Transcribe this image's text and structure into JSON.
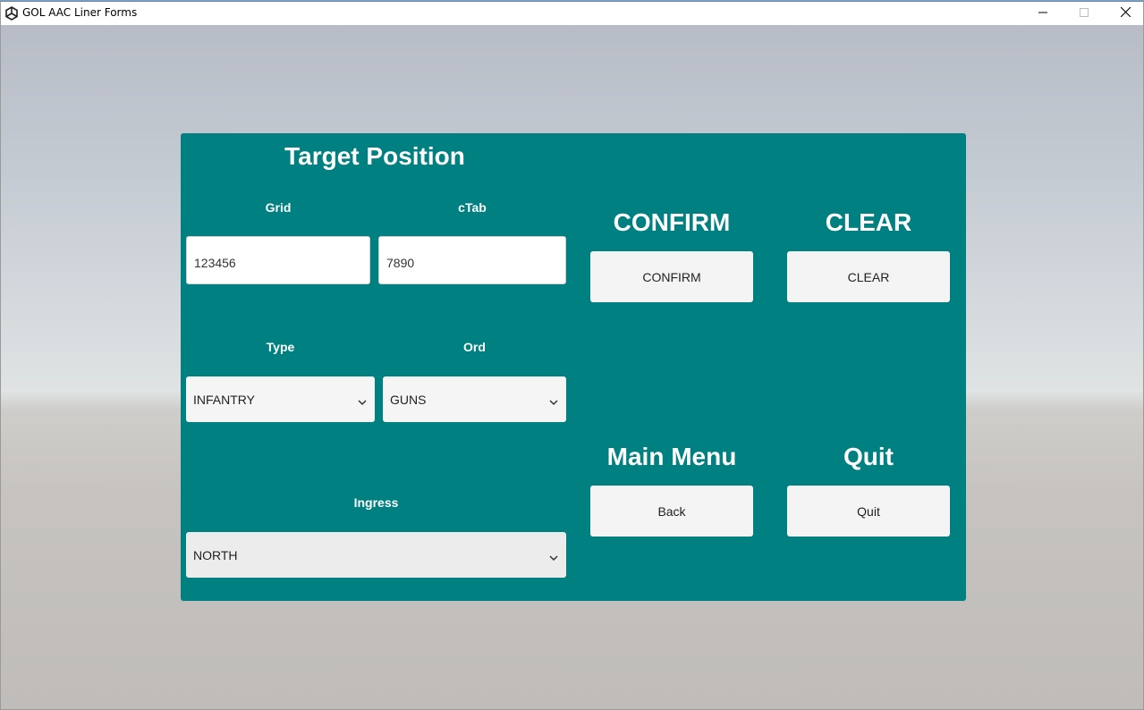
{
  "window": {
    "title": "GOL AAC Liner Forms",
    "controls": [
      "minimize-icon",
      "maximize-icon",
      "close-icon"
    ]
  },
  "panel": {
    "title": "Target Position",
    "background": "#008080"
  },
  "fields": {
    "grid": {
      "label": "Grid",
      "value": "123456"
    },
    "ctab": {
      "label": "cTab",
      "value": "7890"
    },
    "type": {
      "label": "Type",
      "selected": "INFANTRY"
    },
    "ord": {
      "label": "Ord",
      "selected": "GUNS"
    },
    "ingress": {
      "label": "Ingress",
      "selected": "NORTH"
    }
  },
  "actions": {
    "confirm": {
      "heading": "CONFIRM",
      "button": "CONFIRM"
    },
    "clear": {
      "heading": "CLEAR",
      "button": "CLEAR"
    },
    "main_menu": {
      "heading": "Main Menu",
      "button": "Back"
    },
    "quit": {
      "heading": "Quit",
      "button": "Quit"
    }
  },
  "icons": {
    "app": "unity-logo-icon",
    "dropdown": "chevron-down-icon"
  }
}
